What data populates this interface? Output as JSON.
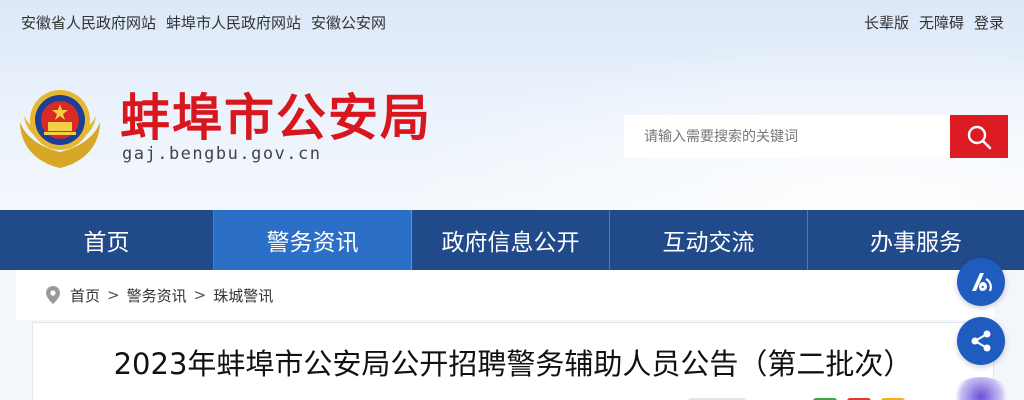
{
  "topbar": {
    "links": [
      "安徽省人民政府网站",
      "蚌埠市人民政府网站",
      "安徽公安网"
    ],
    "right": [
      "长辈版",
      "无障碍",
      "登录"
    ]
  },
  "brand": {
    "title": "蚌埠市公安局",
    "domain": "gaj.bengbu.gov.cn"
  },
  "search": {
    "placeholder": "请输入需要搜索的关键词"
  },
  "nav": {
    "items": [
      "首页",
      "警务资讯",
      "政府信息公开",
      "互动交流",
      "办事服务"
    ],
    "active_index": 1
  },
  "breadcrumb": [
    "首页",
    "警务资讯",
    "珠城警讯"
  ],
  "article": {
    "title": "2023年蚌埠市公安局公开招聘警务辅助人员公告（第二批次）"
  },
  "colors": {
    "brand_red": "#d7171d",
    "nav_blue": "#214a8a",
    "nav_active": "#2c6fc6",
    "float_blue": "#1f5cbf"
  }
}
